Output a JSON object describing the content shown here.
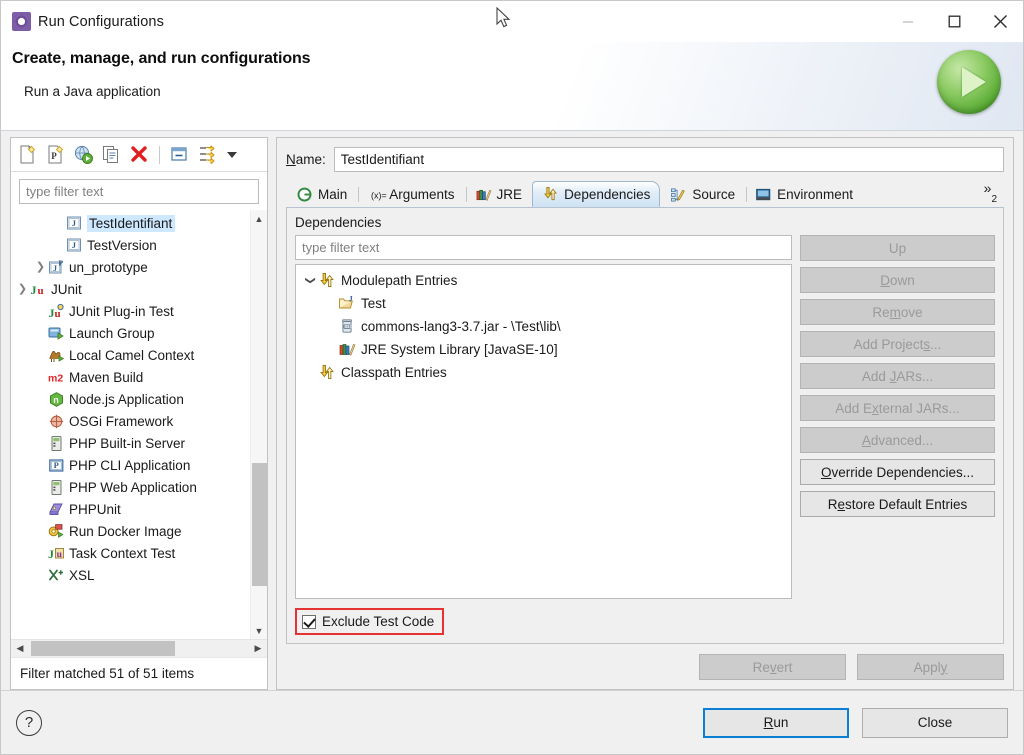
{
  "window": {
    "title": "Run Configurations",
    "title_icon": "run-configurations-icon",
    "minimize_label": "Minimize",
    "maximize_label": "Maximize",
    "close_label": "Close"
  },
  "header": {
    "heading": "Create, manage, and run configurations",
    "subtitle": "Run a Java application",
    "icon": "green-run-play-icon"
  },
  "left_panel": {
    "toolbar": [
      {
        "name": "new-launch-configuration-icon",
        "label": "New launch configuration"
      },
      {
        "name": "new-prototype-icon",
        "label": "New prototype"
      },
      {
        "name": "export-launch-configuration-icon",
        "label": "Export"
      },
      {
        "name": "duplicate-icon",
        "label": "Duplicate"
      },
      {
        "name": "delete-icon",
        "label": "Delete"
      },
      {
        "name": "collapse-all-icon",
        "label": "Collapse All"
      },
      {
        "name": "filter-icon",
        "label": "Filter launch configurations"
      },
      {
        "name": "view-menu-caret-icon",
        "label": "View Menu"
      }
    ],
    "filter_placeholder": "type filter text",
    "filter_value": "",
    "tree": [
      {
        "label": "TestIdentifiant",
        "icon": "java-launch-icon",
        "indent": 2,
        "twisty": "",
        "selected": true
      },
      {
        "label": "TestVersion",
        "icon": "java-launch-icon",
        "indent": 2,
        "twisty": "",
        "selected": false
      },
      {
        "label": "un_prototype",
        "icon": "java-prototype-icon",
        "indent": 1,
        "twisty": "collapsed",
        "selected": false
      },
      {
        "label": "JUnit",
        "icon": "junit-icon",
        "indent": 0,
        "twisty": "collapsed",
        "selected": false
      },
      {
        "label": "JUnit Plug-in Test",
        "icon": "junit-plugin-icon",
        "indent": 1,
        "twisty": "",
        "selected": false
      },
      {
        "label": "Launch Group",
        "icon": "launch-group-icon",
        "indent": 1,
        "twisty": "",
        "selected": false
      },
      {
        "label": "Local Camel Context",
        "icon": "camel-icon",
        "indent": 1,
        "twisty": "",
        "selected": false
      },
      {
        "label": "Maven Build",
        "icon": "maven-icon",
        "indent": 1,
        "twisty": "",
        "selected": false
      },
      {
        "label": "Node.js Application",
        "icon": "nodejs-icon",
        "indent": 1,
        "twisty": "",
        "selected": false
      },
      {
        "label": "OSGi Framework",
        "icon": "osgi-icon",
        "indent": 1,
        "twisty": "",
        "selected": false
      },
      {
        "label": "PHP Built-in Server",
        "icon": "php-server-icon",
        "indent": 1,
        "twisty": "",
        "selected": false
      },
      {
        "label": "PHP CLI Application",
        "icon": "php-cli-icon",
        "indent": 1,
        "twisty": "",
        "selected": false
      },
      {
        "label": "PHP Web Application",
        "icon": "php-server-icon",
        "indent": 1,
        "twisty": "",
        "selected": false
      },
      {
        "label": "PHPUnit",
        "icon": "phpunit-icon",
        "indent": 1,
        "twisty": "",
        "selected": false
      },
      {
        "label": "Run Docker Image",
        "icon": "docker-icon",
        "indent": 1,
        "twisty": "",
        "selected": false
      },
      {
        "label": "Task Context Test",
        "icon": "task-context-icon",
        "indent": 1,
        "twisty": "",
        "selected": false
      },
      {
        "label": "XSL",
        "icon": "xsl-icon",
        "indent": 1,
        "twisty": "",
        "selected": false
      }
    ],
    "status": "Filter matched 51 of 51 items"
  },
  "right_panel": {
    "name_label": "Name:",
    "name_mnemonic": "N",
    "name_value": "TestIdentifiant",
    "tabs": [
      {
        "label": "Main",
        "icon": "main-tab-icon",
        "active": false
      },
      {
        "label": "Arguments",
        "icon": "arguments-tab-icon",
        "active": false
      },
      {
        "label": "JRE",
        "icon": "jre-tab-icon",
        "active": false
      },
      {
        "label": "Dependencies",
        "icon": "dependencies-tab-icon",
        "active": true
      },
      {
        "label": "Source",
        "icon": "source-tab-icon",
        "active": false
      },
      {
        "label": "Environment",
        "icon": "environment-tab-icon",
        "active": false
      }
    ],
    "tab_overflow_count": "2",
    "tab_overflow_chevron": "»",
    "dependencies": {
      "section_label": "Dependencies",
      "filter_placeholder": "type filter text",
      "filter_value": "",
      "tree": [
        {
          "label": "Modulepath Entries",
          "icon": "modulepath-entries-icon",
          "indent": 0,
          "twisty": "expanded"
        },
        {
          "label": "Test",
          "icon": "java-project-folder-icon",
          "indent": 1,
          "twisty": ""
        },
        {
          "label": "commons-lang3-3.7.jar - \\Test\\lib\\",
          "icon": "jar-icon",
          "indent": 1,
          "twisty": ""
        },
        {
          "label": "JRE System Library [JavaSE-10]",
          "icon": "jre-library-icon",
          "indent": 1,
          "twisty": ""
        },
        {
          "label": "Classpath Entries",
          "icon": "classpath-entries-icon",
          "indent": 0,
          "twisty": ""
        }
      ],
      "buttons": [
        {
          "label": "Up",
          "mnemonic": "",
          "enabled": false
        },
        {
          "label": "Down",
          "mnemonic": "D",
          "enabled": false
        },
        {
          "label": "Remove",
          "mnemonic": "m",
          "enabled": false
        },
        {
          "label": "Add Projects...",
          "mnemonic": "s",
          "enabled": false
        },
        {
          "label": "Add JARs...",
          "mnemonic": "J",
          "enabled": false
        },
        {
          "label": "Add External JARs...",
          "mnemonic": "x",
          "enabled": false
        },
        {
          "label": "Advanced...",
          "mnemonic": "A",
          "enabled": false
        },
        {
          "label": "Override Dependencies...",
          "mnemonic": "O",
          "enabled": true
        },
        {
          "label": "Restore Default Entries",
          "mnemonic": "e",
          "enabled": true
        }
      ],
      "exclude_test_code": {
        "label": "Exclude Test Code",
        "checked": true,
        "highlight_color": "#e53232"
      }
    },
    "revert_label": "Revert",
    "revert_mnemonic": "v",
    "revert_enabled": false,
    "apply_label": "Apply",
    "apply_mnemonic": "y",
    "apply_enabled": false
  },
  "footer": {
    "help_label": "?",
    "run_label": "Run",
    "run_mnemonic": "R",
    "close_label": "Close",
    "default_button": "Run",
    "accent_color": "#0b7fd4"
  }
}
